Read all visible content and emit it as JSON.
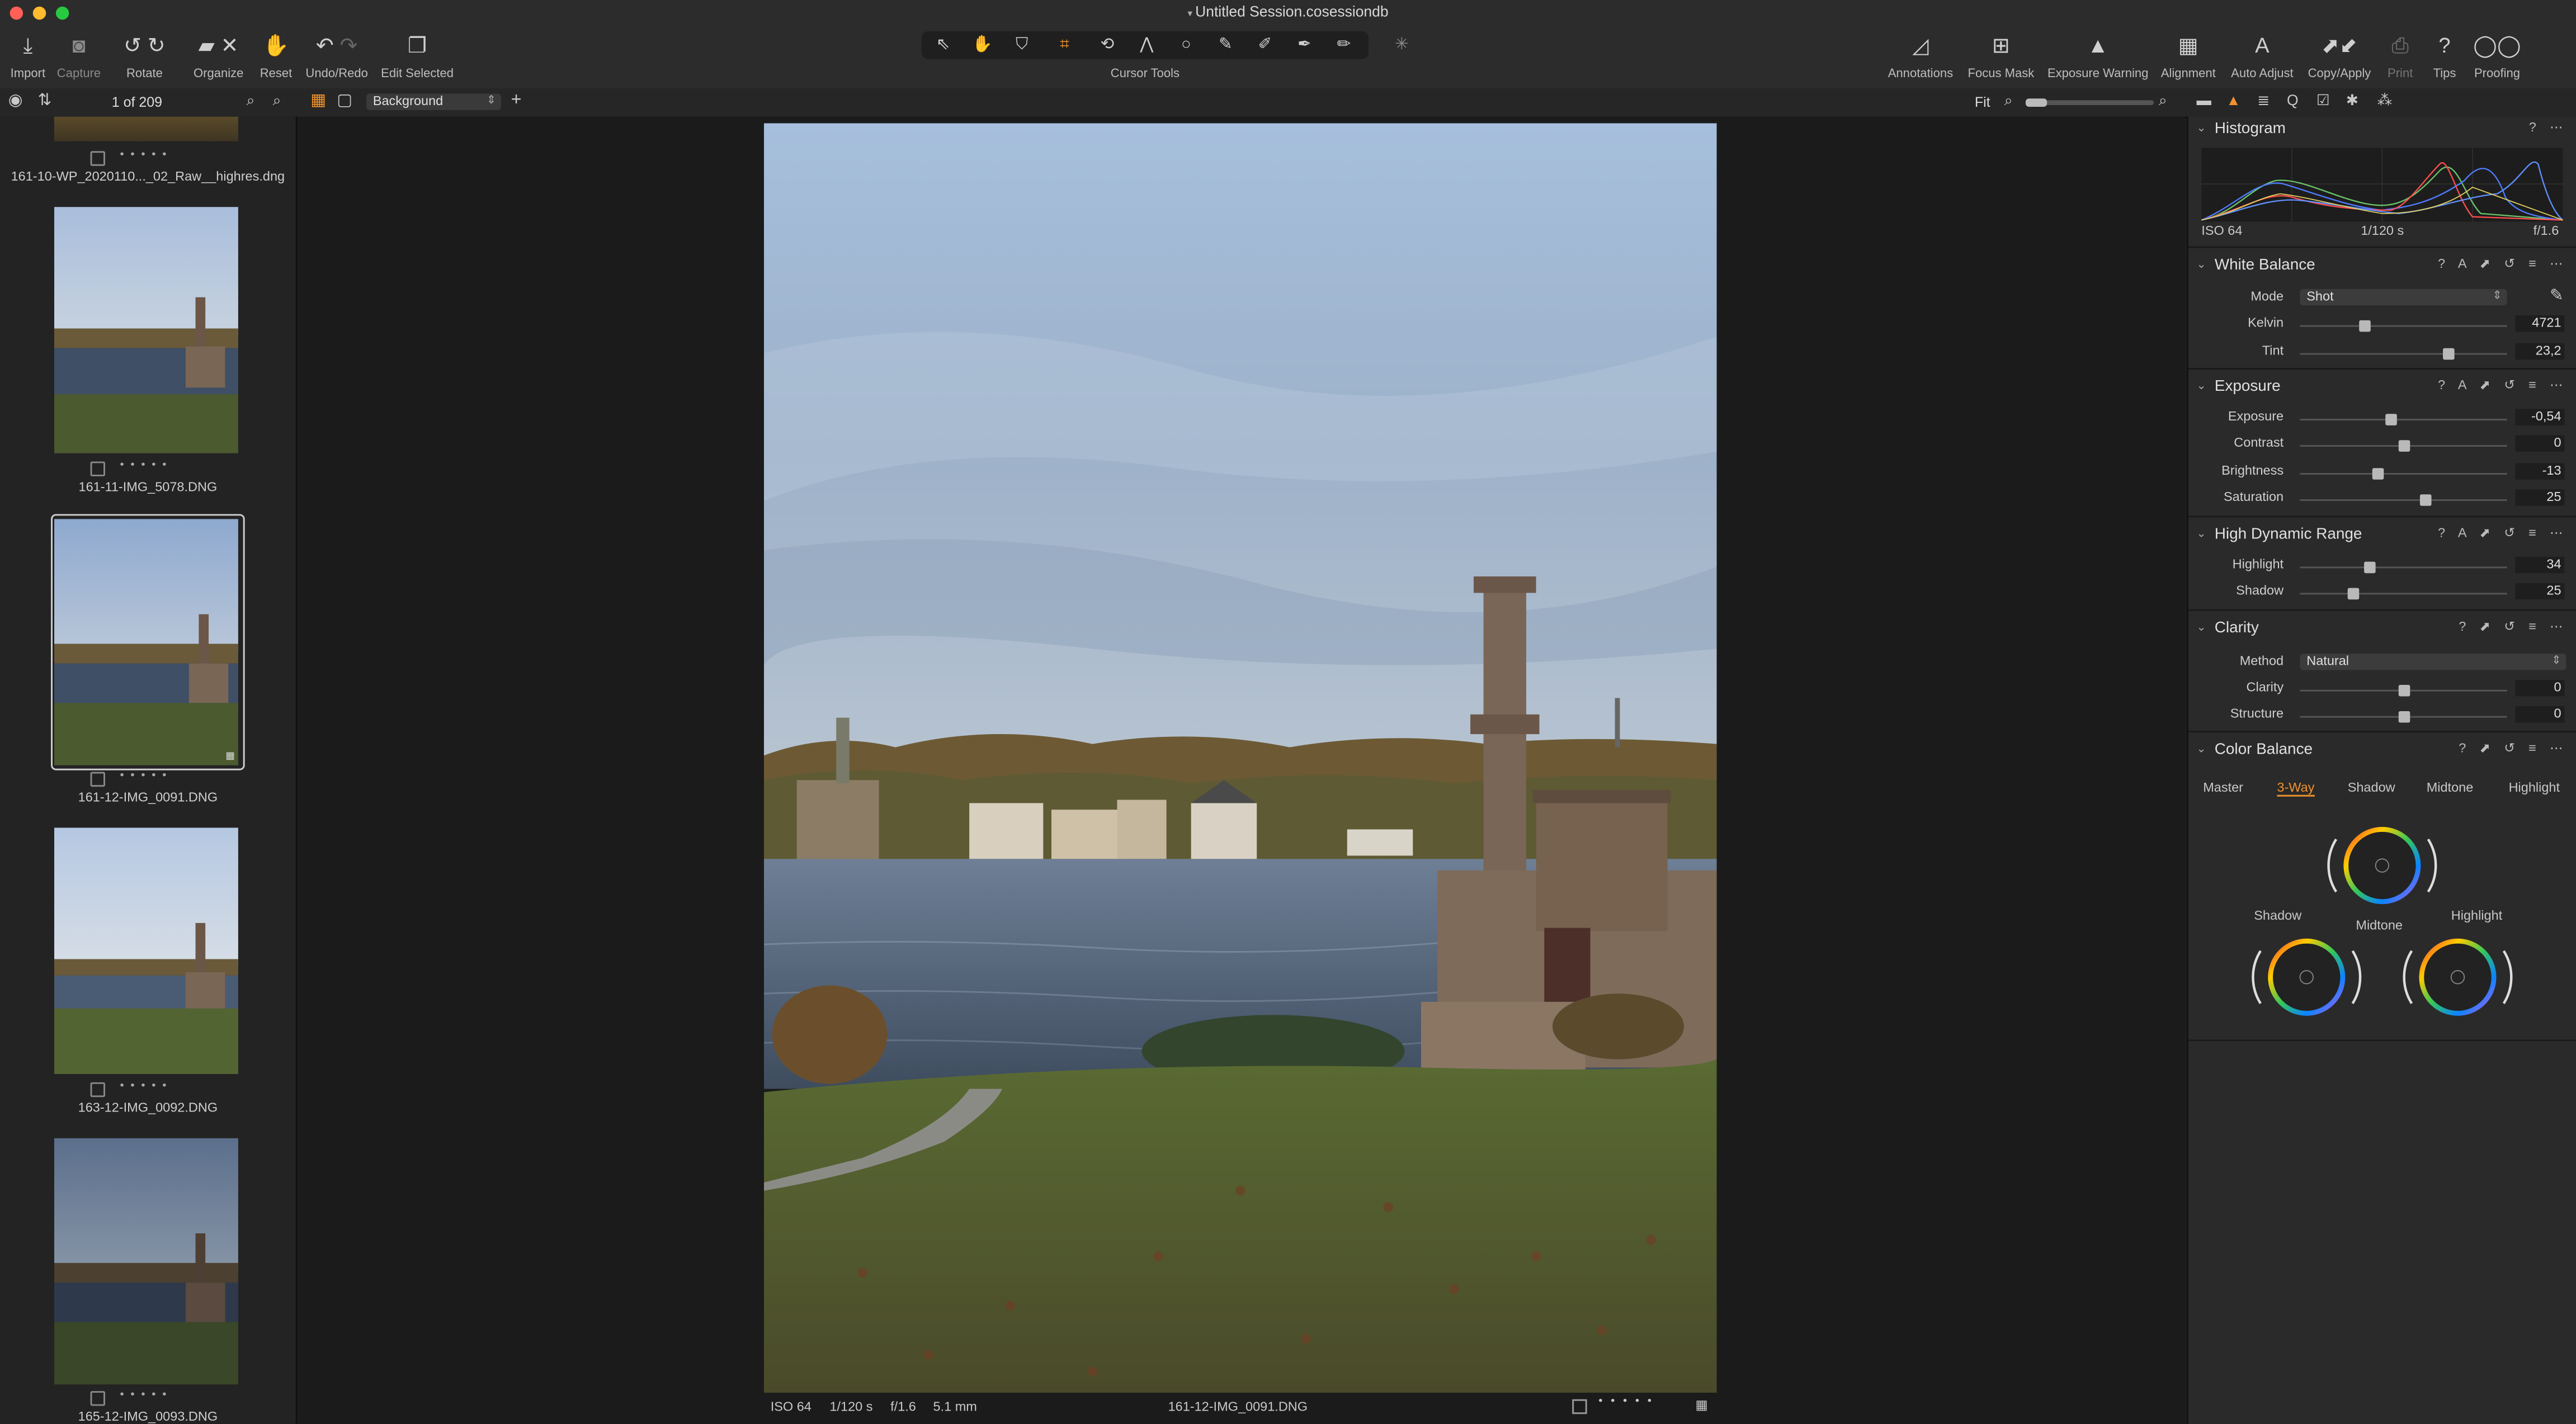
{
  "window": {
    "title": "Untitled Session.cosessiondb"
  },
  "toolbar": {
    "left": [
      {
        "label": "Import",
        "icon": "import-icon"
      },
      {
        "label": "Capture",
        "icon": "camera-icon"
      },
      {
        "label": "Rotate",
        "icon": "rotate-icon"
      },
      {
        "label": "Organize",
        "icon": "organize-icon"
      },
      {
        "label": "Reset",
        "icon": "reset-icon"
      },
      {
        "label": "Undo/Redo",
        "icon": "undo-icon"
      },
      {
        "label": "Edit Selected",
        "icon": "edit-selected-icon"
      }
    ],
    "cursor_tools_label": "Cursor Tools",
    "right": [
      {
        "label": "Annotations",
        "icon": "annotations-icon"
      },
      {
        "label": "Focus Mask",
        "icon": "focus-mask-icon"
      },
      {
        "label": "Exposure Warning",
        "icon": "exposure-warning-icon"
      },
      {
        "label": "Alignment",
        "icon": "alignment-icon"
      },
      {
        "label": "Auto Adjust",
        "icon": "auto-adjust-icon"
      },
      {
        "label": "Copy/Apply",
        "icon": "copy-apply-icon"
      },
      {
        "label": "Print",
        "icon": "print-icon"
      },
      {
        "label": "Tips",
        "icon": "tips-icon"
      },
      {
        "label": "Proofing",
        "icon": "proofing-icon"
      }
    ]
  },
  "subbar": {
    "counter": "1 of 209",
    "background_select": "Background",
    "zoom": "Fit"
  },
  "browser": {
    "items": [
      {
        "name": "161-10-WP_2020110..._02_Raw__highres.dng"
      },
      {
        "name": "161-11-IMG_5078.DNG"
      },
      {
        "name": "161-12-IMG_0091.DNG"
      },
      {
        "name": "163-12-IMG_0092.DNG"
      },
      {
        "name": "165-12-IMG_0093.DNG"
      }
    ]
  },
  "viewer": {
    "iso": "ISO 64",
    "shutter": "1/120 s",
    "aperture": "f/1.6",
    "focal": "5.1 mm",
    "filename": "161-12-IMG_0091.DNG"
  },
  "histogram": {
    "title": "Histogram",
    "iso": "ISO 64",
    "shutter": "1/120 s",
    "aperture": "f/1.6"
  },
  "white_balance": {
    "title": "White Balance",
    "mode_label": "Mode",
    "mode_value": "Shot",
    "kelvin_label": "Kelvin",
    "kelvin": "4721",
    "kelvin_level": 0.31,
    "tint_label": "Tint",
    "tint": "23,2",
    "tint_level": 0.72
  },
  "exposure": {
    "title": "Exposure",
    "rows": [
      {
        "label": "Exposure",
        "value": "-0,54",
        "level": 0.44
      },
      {
        "label": "Contrast",
        "value": "0",
        "level": 0.5
      },
      {
        "label": "Brightness",
        "value": "-13",
        "level": 0.38
      },
      {
        "label": "Saturation",
        "value": "25",
        "level": 0.61
      }
    ]
  },
  "hdr": {
    "title": "High Dynamic Range",
    "rows": [
      {
        "label": "Highlight",
        "value": "34",
        "level": 0.34
      },
      {
        "label": "Shadow",
        "value": "25",
        "level": 0.26
      }
    ]
  },
  "clarity": {
    "title": "Clarity",
    "method_label": "Method",
    "method_value": "Natural",
    "rows": [
      {
        "label": "Clarity",
        "value": "0",
        "level": 0.5
      },
      {
        "label": "Structure",
        "value": "0",
        "level": 0.5
      }
    ]
  },
  "color_balance": {
    "title": "Color Balance",
    "tabs": [
      "Master",
      "3-Way",
      "Shadow",
      "Midtone",
      "Highlight"
    ],
    "active_tab": "3-Way",
    "wheel_labels": {
      "shadow": "Shadow",
      "midtone": "Midtone",
      "highlight": "Highlight"
    },
    "accent": "#f0922b"
  }
}
